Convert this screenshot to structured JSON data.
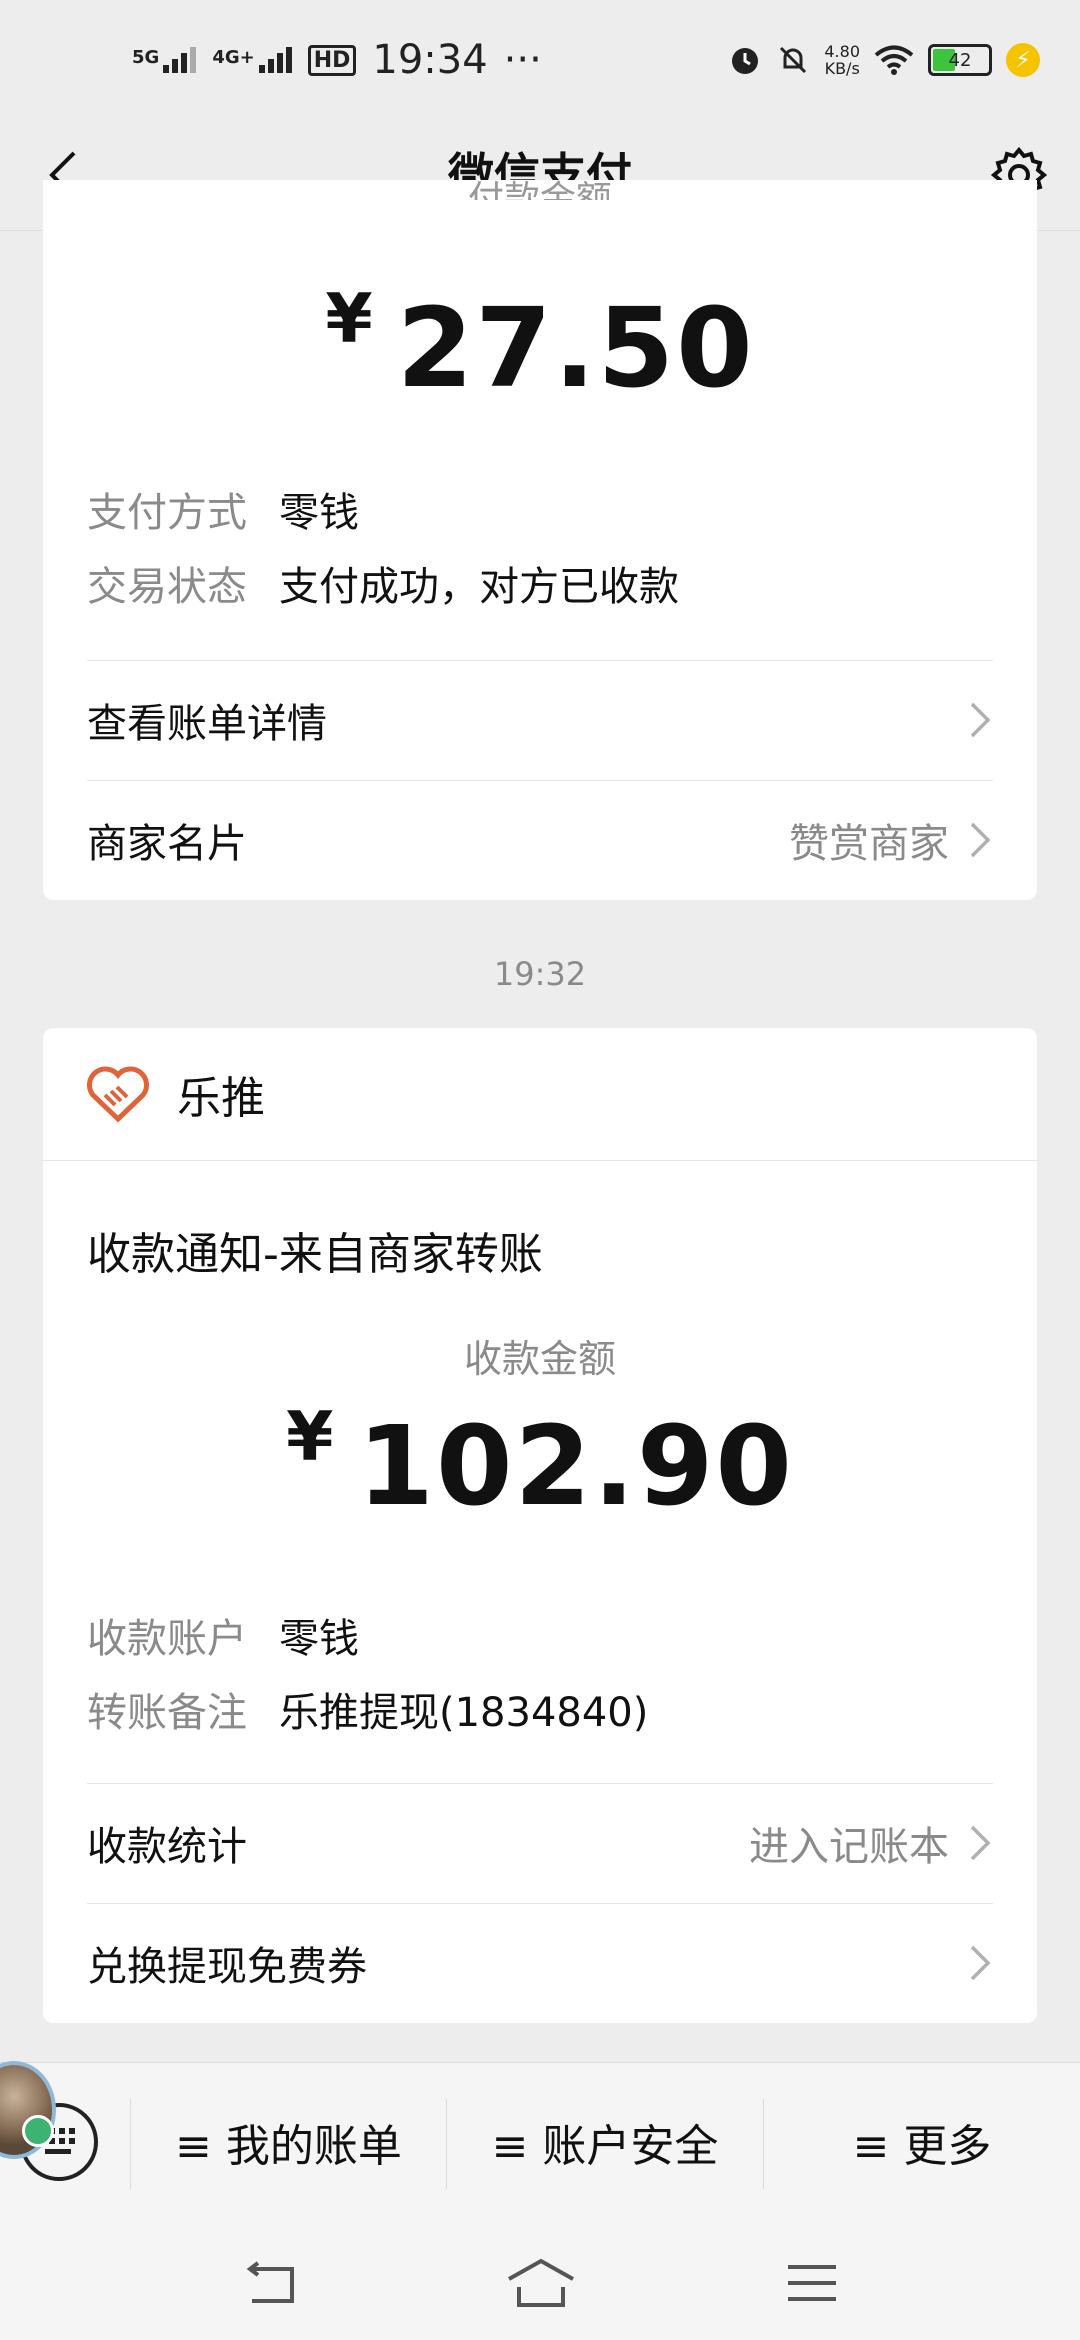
{
  "status_bar": {
    "net1": "5G",
    "net2": "4G+",
    "hd": "HD",
    "time": "19:34",
    "more": "···",
    "speed_value": "4.80",
    "speed_unit": "KB/s",
    "battery": "42"
  },
  "nav": {
    "title": "微信支付"
  },
  "payment_card": {
    "amount_label": "付款金额",
    "currency": "¥",
    "amount": "27.50",
    "rows": [
      {
        "key": "支付方式",
        "value": "零钱"
      },
      {
        "key": "交易状态",
        "value": "支付成功，对方已收款"
      }
    ],
    "link_bill": "查看账单详情",
    "merchant_card_label": "商家名片",
    "merchant_card_action": "赞赏商家"
  },
  "timestamp": "19:32",
  "receipt_card": {
    "merchant_name": "乐推",
    "notice_title": "收款通知-来自商家转账",
    "amount_label": "收款金额",
    "currency": "¥",
    "amount": "102.90",
    "rows": [
      {
        "key": "收款账户",
        "value": "零钱"
      },
      {
        "key": "转账备注",
        "value": "乐推提现(1834840)"
      }
    ],
    "stats_label": "收款统计",
    "stats_action": "进入记账本",
    "coupon_label": "兑换提现免费券"
  },
  "bottom_menu": {
    "items": [
      "≡ 我的账单",
      "≡ 账户安全",
      "≡ 更多"
    ]
  },
  "colors": {
    "background": "#ededed",
    "card": "#ffffff",
    "secondary_text": "#8a8a8a",
    "merchant_icon": "#e0633a"
  }
}
